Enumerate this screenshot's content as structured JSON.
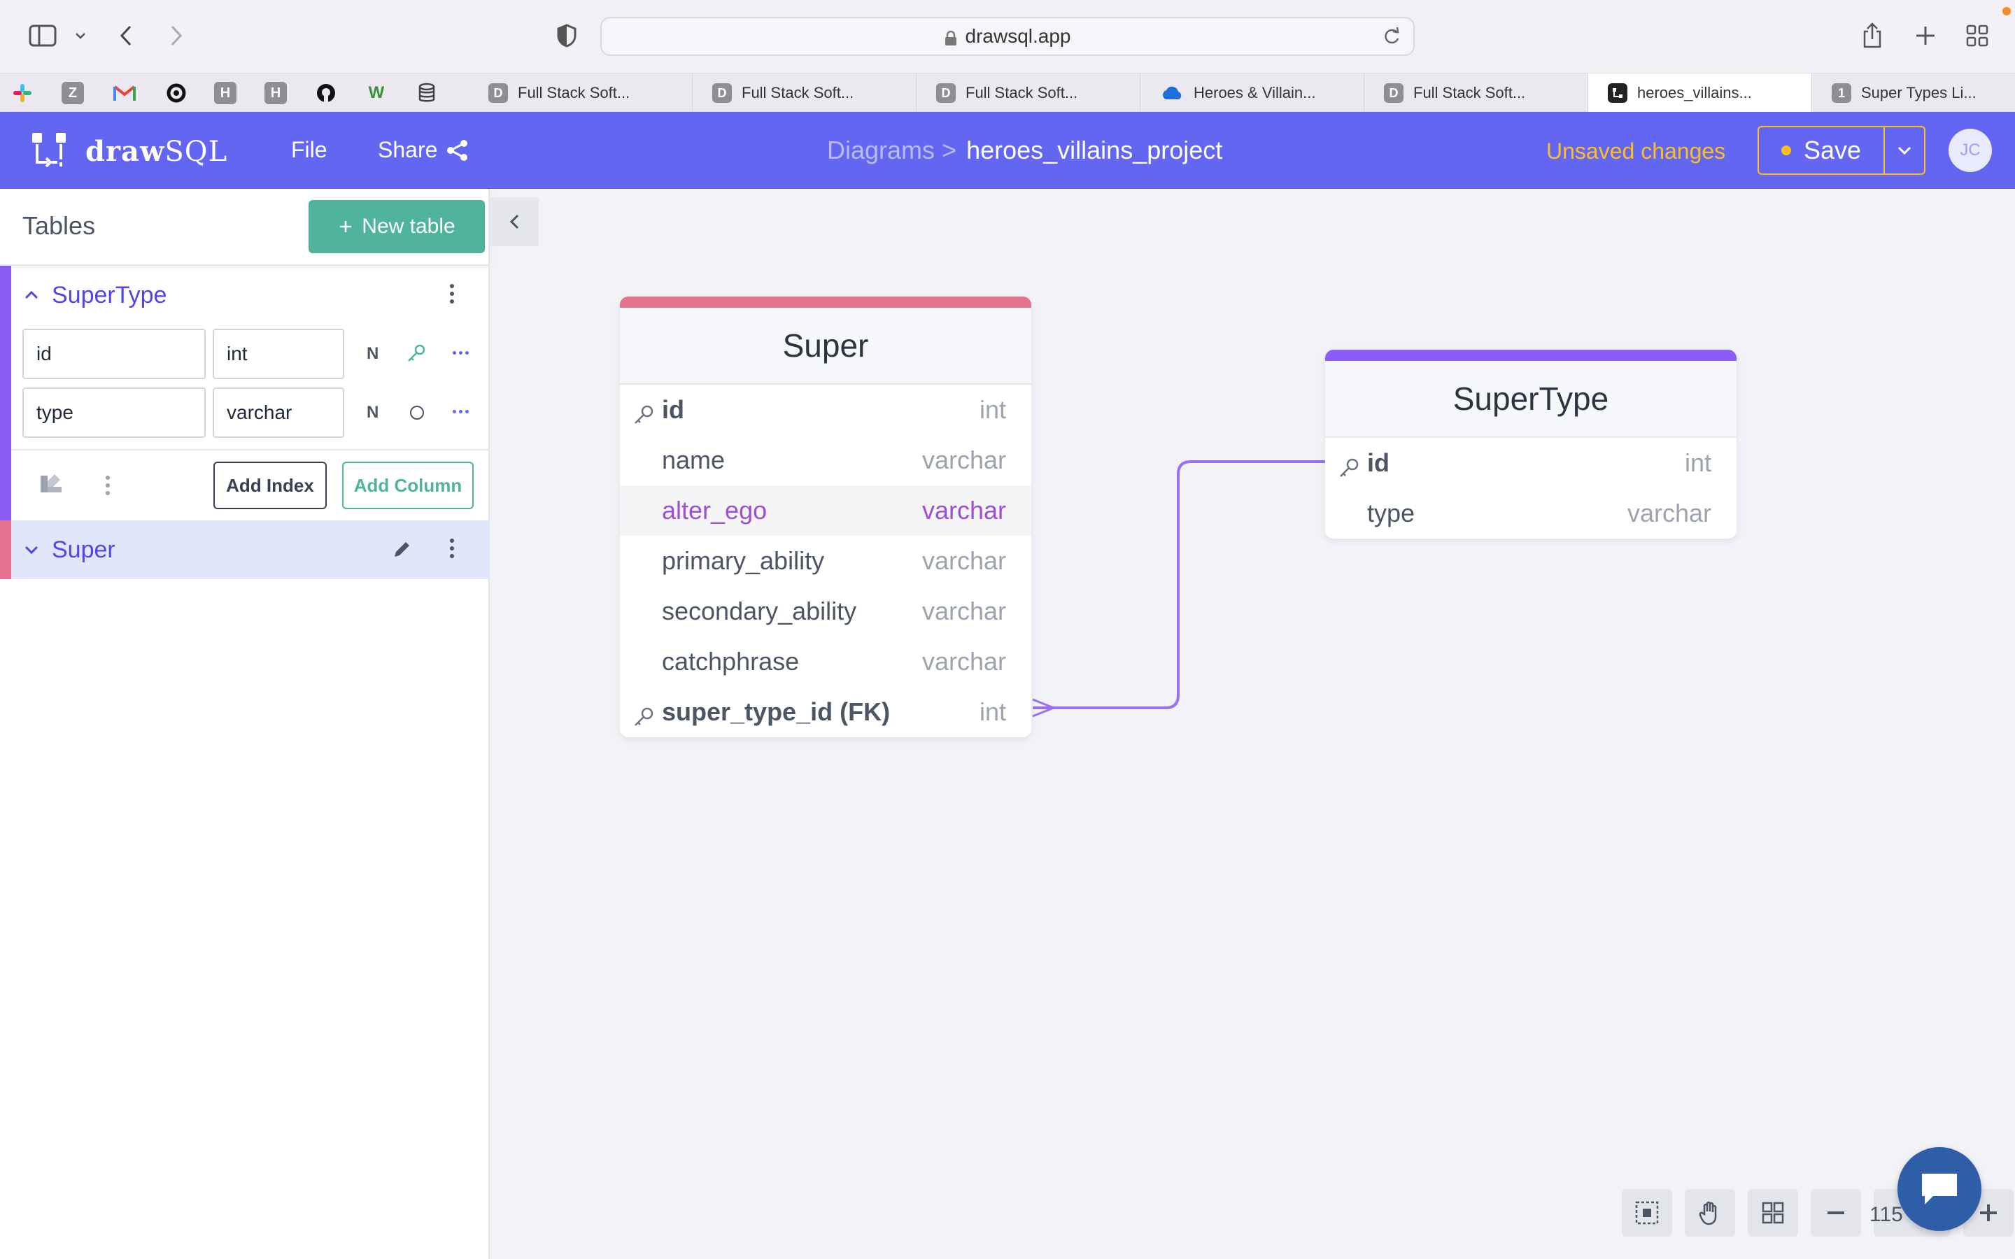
{
  "browser": {
    "url": "drawsql.app",
    "pinned_tabs": [
      "slack",
      "Z",
      "gmail",
      "circle",
      "H",
      "H",
      "github",
      "W",
      "database"
    ],
    "tabs": [
      {
        "favicon": "D",
        "label": "Full Stack Soft..."
      },
      {
        "favicon": "D",
        "label": "Full Stack Soft..."
      },
      {
        "favicon": "D",
        "label": "Full Stack Soft..."
      },
      {
        "favicon": "cloud",
        "label": "Heroes & Villain..."
      },
      {
        "favicon": "D",
        "label": "Full Stack Soft..."
      },
      {
        "favicon": "drawsql",
        "label": "heroes_villains...",
        "active": true
      },
      {
        "favicon": "1",
        "label": "Super Types Li..."
      }
    ]
  },
  "header": {
    "logo_bold": "draw",
    "logo_rest": "SQL",
    "file_label": "File",
    "share_label": "Share",
    "breadcrumb_root": "Diagrams >",
    "project_name": "heroes_villains_project",
    "unsaved_label": "Unsaved changes",
    "save_label": "Save",
    "avatar_initials": "JC",
    "accent_color": "#6366f1",
    "warning_color": "#fbbf24"
  },
  "sidebar": {
    "title": "Tables",
    "new_table_label": "New table",
    "tables": [
      {
        "name": "SuperType",
        "color": "#8b5cf6",
        "expanded": true,
        "columns": [
          {
            "name": "id",
            "type": "int",
            "nullable_label": "N",
            "icon": "key-icon"
          },
          {
            "name": "type",
            "type": "varchar",
            "nullable_label": "N",
            "icon": "circle-icon"
          }
        ],
        "add_index_label": "Add Index",
        "add_column_label": "Add Column"
      },
      {
        "name": "Super",
        "color": "#e5728f",
        "expanded": false
      }
    ]
  },
  "diagram": {
    "tables": [
      {
        "name": "Super",
        "color": "#e5728f",
        "columns": [
          {
            "name": "id",
            "type": "int",
            "pk": true
          },
          {
            "name": "name",
            "type": "varchar"
          },
          {
            "name": "alter_ego",
            "type": "varchar",
            "highlighted": true
          },
          {
            "name": "primary_ability",
            "type": "varchar"
          },
          {
            "name": "secondary_ability",
            "type": "varchar"
          },
          {
            "name": "catchphrase",
            "type": "varchar"
          },
          {
            "name": "super_type_id (FK)",
            "type": "int",
            "fk": true
          }
        ]
      },
      {
        "name": "SuperType",
        "color": "#8b5cf6",
        "columns": [
          {
            "name": "id",
            "type": "int",
            "pk": true
          },
          {
            "name": "type",
            "type": "varchar"
          }
        ]
      }
    ],
    "relation_color": "#9d6ff0"
  },
  "footer": {
    "zoom_label": "115"
  }
}
